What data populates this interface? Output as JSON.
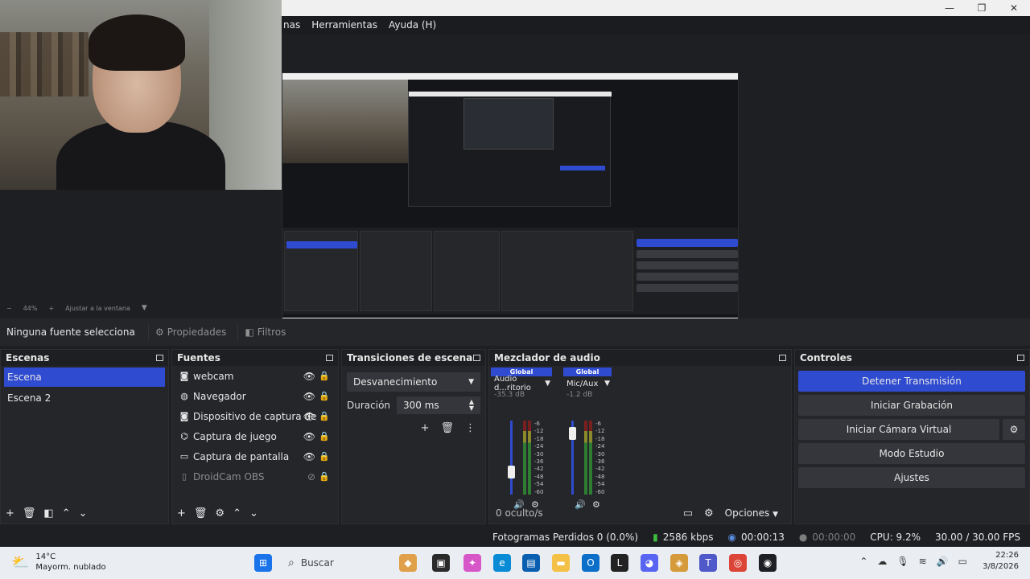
{
  "window": {
    "minimize_icon": "minimize-icon",
    "maximize_icon": "maximize-icon",
    "close_icon": "close-icon"
  },
  "menu": {
    "items": [
      "nas",
      "Herramientas",
      "Ayuda (H)"
    ]
  },
  "zoom": {
    "minus": "−",
    "value": "44%",
    "plus": "+",
    "fit_label": "Ajustar a la ventana"
  },
  "source_toolbar": {
    "selected_label": "Ninguna fuente selecciona",
    "properties_label": "Propiedades",
    "filters_label": "Filtros"
  },
  "scenes": {
    "title": "Escenas",
    "items": [
      "Escena",
      "Escena 2"
    ]
  },
  "sources": {
    "title": "Fuentes",
    "items": [
      {
        "label": "webcam",
        "icon": "camera-icon"
      },
      {
        "label": "Navegador",
        "icon": "globe-icon"
      },
      {
        "label": "Dispositivo de captura de",
        "icon": "camera-icon"
      },
      {
        "label": "Captura de juego",
        "icon": "gamepad-icon"
      },
      {
        "label": "Captura de pantalla",
        "icon": "monitor-icon"
      },
      {
        "label": "DroidCam OBS",
        "icon": "document-icon"
      }
    ]
  },
  "transitions": {
    "title": "Transiciones de escena",
    "selected": "Desvanecimiento",
    "duration_label": "Duración",
    "duration_value": "300 ms"
  },
  "mixer": {
    "title": "Mezclador de audio",
    "channels": [
      {
        "badge": "Global",
        "name": "Audio d...ritorio",
        "db": "-35.3 dB"
      },
      {
        "badge": "Global",
        "name": "Mic/Aux",
        "db": "-1.2 dB"
      }
    ],
    "ticks": [
      "-6",
      "-12",
      "-18",
      "-24",
      "-30",
      "-36",
      "-42",
      "-48",
      "-54",
      "-60"
    ],
    "hidden_label": "0 oculto/s",
    "options_label": "Opciones"
  },
  "controls": {
    "title": "Controles",
    "stop_stream": "Detener Transmisión",
    "start_recording": "Iniciar Grabación",
    "start_virtual_cam": "Iniciar Cámara Virtual",
    "studio_mode": "Modo Estudio",
    "settings": "Ajustes"
  },
  "status": {
    "dropped_frames": "Fotogramas Perdidos 0 (0.0%)",
    "bitrate": "2586 kbps",
    "stream_time": "00:00:13",
    "record_time": "00:00:00",
    "cpu": "CPU: 9.2%",
    "fps": "30.00 / 30.00 FPS"
  },
  "taskbar": {
    "temperature": "14°C",
    "weather": "Mayorm. nublado",
    "search_placeholder": "Buscar",
    "time": "22:26",
    "date": "3/8/2026"
  },
  "colors": {
    "accent": "#2f4bd0",
    "panel": "#25262a",
    "background": "#1e1f22"
  }
}
